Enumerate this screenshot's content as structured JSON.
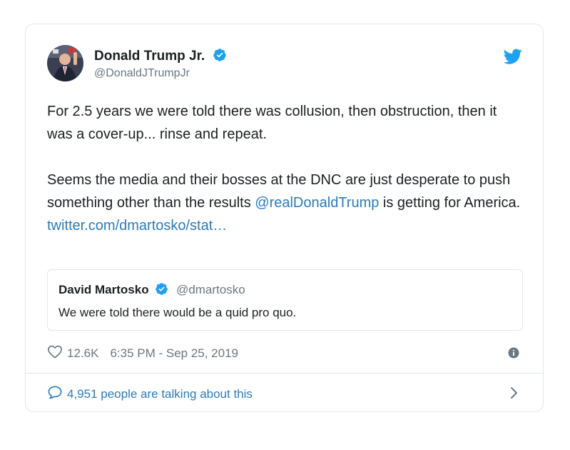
{
  "author": {
    "name": "Donald Trump Jr.",
    "handle": "@DonaldJTrumpJr",
    "verified": true
  },
  "tweet": {
    "paragraph1": "For 2.5 years we were told there was collusion, then obstruction, then it was a cover-up... rinse and repeat.",
    "paragraph2_before_mention": "Seems the media and their bosses at the DNC are just desperate to push something other than the results ",
    "mention": "@realDonaldTrump",
    "paragraph2_after_mention": " is getting for America.",
    "link": "twitter.com/dmartosko/stat…"
  },
  "quoted_tweet": {
    "name": "David Martosko",
    "handle": "@dmartosko",
    "text": "We were told there would be a quid pro quo."
  },
  "meta": {
    "likes": "12.6K",
    "timestamp": "6:35 PM - Sep 25, 2019"
  },
  "footer": {
    "talking": "4,951 people are talking about this"
  },
  "icons": {
    "twitter_bird": "twitter-bird-icon",
    "verified": "verified-badge-icon",
    "heart": "heart-icon",
    "info": "info-icon",
    "reply_bubble": "speech-bubble-icon",
    "chevron": "chevron-right-icon"
  },
  "colors": {
    "twitter_blue": "#1da1f2",
    "link_blue": "#2b7bb9",
    "text": "#1c2022",
    "muted": "#697882",
    "border": "#e1e8ed"
  }
}
